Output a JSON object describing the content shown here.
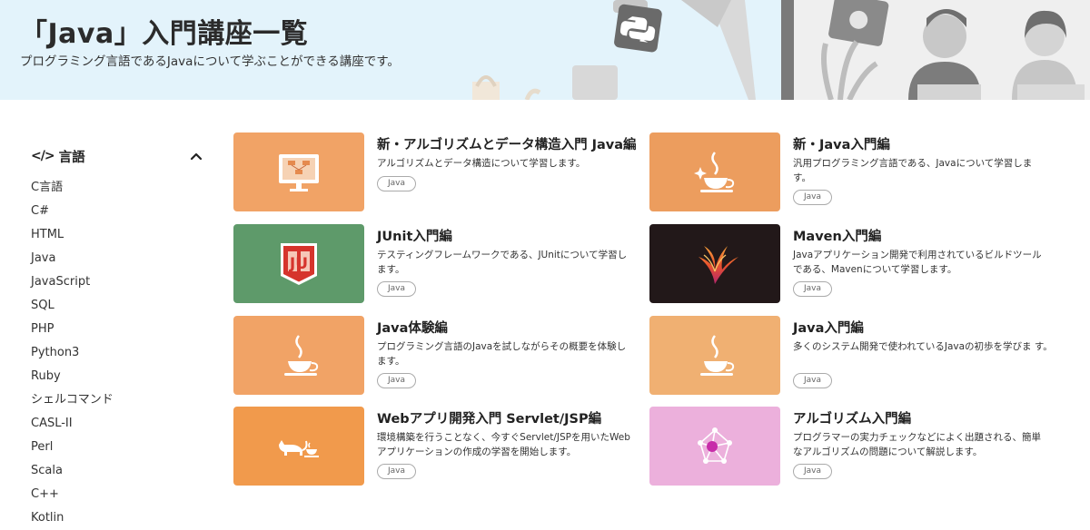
{
  "hero": {
    "title": "「Java」入門講座一覧",
    "subtitle": "プログラミング言語であるJavaについて学ぶことができる講座です。"
  },
  "sidebar": {
    "heading": "言語",
    "heading_icon": "code-icon",
    "collapse_icon": "chevron-up-icon",
    "items": [
      {
        "label": "C言語"
      },
      {
        "label": "C#"
      },
      {
        "label": "HTML"
      },
      {
        "label": "Java"
      },
      {
        "label": "JavaScript"
      },
      {
        "label": "SQL"
      },
      {
        "label": "PHP"
      },
      {
        "label": "Python3"
      },
      {
        "label": "Ruby"
      },
      {
        "label": "シェルコマンド"
      },
      {
        "label": "CASL-II"
      },
      {
        "label": "Perl"
      },
      {
        "label": "Scala"
      },
      {
        "label": "C++"
      },
      {
        "label": "Kotlin"
      }
    ]
  },
  "courses": [
    {
      "title": "新・アルゴリズムとデータ構造入門 Java編",
      "desc": "アルゴリズムとデータ構造について学習します。",
      "tag": "Java",
      "thumb_color": "#f1a366",
      "icon": "monitor-diagram-icon"
    },
    {
      "title": "新・Java入門編",
      "desc": "汎用プログラミング言語である、Javaについて学習しま す。",
      "tag": "Java",
      "thumb_color": "#ec9d5e",
      "icon": "coffee-cup-icon"
    },
    {
      "title": "JUnit入門編",
      "desc": "テスティングフレームワークである、JUnitについて学習し ます。",
      "tag": "Java",
      "thumb_color": "#5e9a6a",
      "icon": "junit-logo-icon"
    },
    {
      "title": "Maven入門編",
      "desc": "Javaアプリケーション開発で利用されているビルドツール である、Mavenについて学習します。",
      "tag": "Java",
      "thumb_color": "#221819",
      "icon": "maven-feather-icon"
    },
    {
      "title": "Java体験編",
      "desc": "プログラミング言語のJavaを試しながらその概要を体験し ます。",
      "tag": "Java",
      "thumb_color": "#f1a366",
      "icon": "coffee-cup-icon"
    },
    {
      "title": "Java入門編",
      "desc": "多くのシステム開発で使われているJavaの初歩を学びま す。",
      "tag": "Java",
      "thumb_color": "#f0b072",
      "icon": "coffee-cup-icon"
    },
    {
      "title": "Webアプリ開発入門 Servlet/JSP編",
      "desc": "環境構築を行うことなく、今すぐServlet/JSPを用いたWeb アプリケーションの作成の学習を開始します。",
      "tag": "Java",
      "thumb_color": "#f19a4c",
      "icon": "cat-and-cup-icon"
    },
    {
      "title": "アルゴリズム入門編",
      "desc": "プログラマーの実力チェックなどによく出題される、簡単 なアルゴリズムの問題について解説します。",
      "tag": "Java",
      "thumb_color": "#ecb0dc",
      "icon": "network-graph-icon"
    }
  ]
}
